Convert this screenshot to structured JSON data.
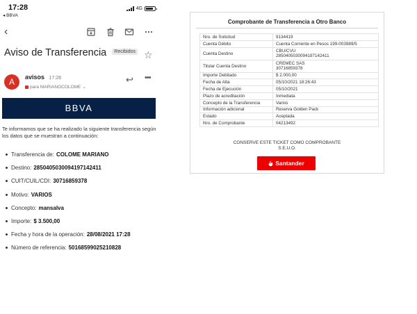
{
  "status_bar": {
    "time": "17:28",
    "back_app": "◂ BBVA",
    "network": "4G"
  },
  "email": {
    "subject": "Aviso de Transferencia",
    "label": "Recibidos",
    "sender": {
      "initial": "A",
      "name": "avisos",
      "time": "17:28",
      "to": "para MARIANOCOLOME"
    },
    "banner": {
      "logo_text": "BBVA",
      "color": "#072146"
    },
    "intro": "Te informamos que se ha realizado la siguiente transferencia según los datos que se muestran a continuación:",
    "details": [
      {
        "label": "Transferencia de:",
        "value": "COLOME MARIANO"
      },
      {
        "label": "Destino:",
        "value": "2850405030094197142411"
      },
      {
        "label": "CUIT/CUIL/CDI:",
        "value": "30716859378"
      },
      {
        "label": "Motivo:",
        "value": "VARIOS"
      },
      {
        "label": "Concepto:",
        "value": "mansalva"
      },
      {
        "label": "Importe:",
        "value": "$ 3.500,00"
      },
      {
        "label": "Fecha y hora de la operación:",
        "value": "28/08/2021 17:28"
      },
      {
        "label": "Número de referencia:",
        "value": "50168599025210828"
      }
    ],
    "icons": [
      "back-arrow-icon",
      "archive-icon",
      "trash-icon",
      "mail-icon",
      "more-icon",
      "star-icon",
      "reply-icon"
    ]
  },
  "receipt": {
    "title": "Comprobante de Transferencia a Otro Banco",
    "rows": [
      {
        "key": "Nro. de Solicitud",
        "value": "9134419"
      },
      {
        "key": "Cuenta Débito",
        "value": "Cuenta Corriente en Pesos 199-003989/5"
      },
      {
        "key": "Cuenta Destino",
        "value": "CBU/CVU",
        "value2": "2850405030094197142411"
      },
      {
        "key": "Titular Cuenta Destino",
        "value": "CREMEC SAS",
        "value2": "30716859378"
      },
      {
        "key": "Importe Debitado",
        "value": "$ 2.000,00"
      },
      {
        "key": "Fecha de Alta",
        "value": "05/10/2021 18:26:43"
      },
      {
        "key": "Fecha de Ejecución",
        "value": "05/10/2021"
      },
      {
        "key": "Plazo de acreditación",
        "value": "Inmediata"
      },
      {
        "key": "Concepto de la Transferencia",
        "value": "Varios"
      },
      {
        "key": "Información adicional",
        "value": "Reserva Golden Pack"
      },
      {
        "key": "Estado",
        "value": "Aceptada"
      },
      {
        "key": "Nro. de Comprobante",
        "value": "04213492"
      }
    ],
    "footer_line1": "CONSERVE ESTE TICKET COMO COMPROBANTE",
    "footer_line2": "S.E.U.O.",
    "brand": {
      "name": "Santander",
      "color": "#ec0000"
    }
  }
}
